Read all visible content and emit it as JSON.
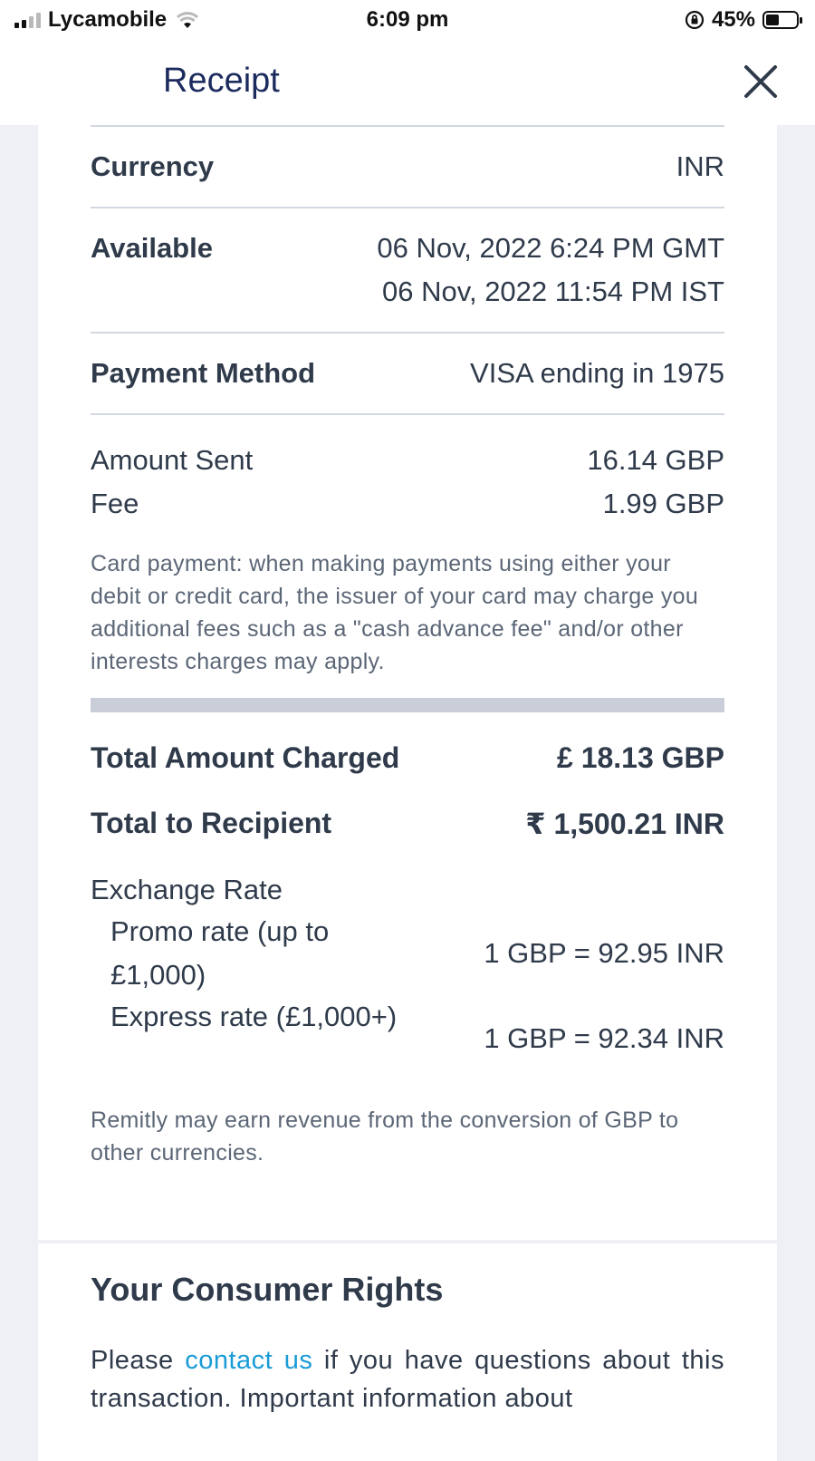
{
  "status_bar": {
    "carrier": "Lycamobile",
    "time": "6:09 pm",
    "battery": "45%",
    "battery_level": 0.45,
    "icons": [
      "signal-icon",
      "wifi-icon",
      "orientation-lock-icon",
      "battery-icon"
    ]
  },
  "header": {
    "title": "Receipt",
    "close_icon": "close-icon"
  },
  "details": {
    "currency": {
      "label": "Currency",
      "value": "INR"
    },
    "available": {
      "label": "Available",
      "value_gmt": "06 Nov, 2022 6:24 PM GMT",
      "value_ist": "06 Nov, 2022 11:54 PM IST"
    },
    "payment_method": {
      "label": "Payment Method",
      "value": "VISA ending in 1975"
    },
    "amount_sent": {
      "label": "Amount Sent",
      "value": "16.14 GBP"
    },
    "fee": {
      "label": "Fee",
      "value": "1.99 GBP"
    },
    "card_note": "Card payment: when making payments using either your debit or credit card, the issuer of your card may charge you additional fees such as a \"cash advance fee\" and/or other interests charges may apply."
  },
  "totals": {
    "charged": {
      "label": "Total Amount Charged",
      "value": "£ 18.13 GBP"
    },
    "recipient": {
      "label": "Total to Recipient",
      "value": "₹ 1,500.21 INR"
    }
  },
  "exchange": {
    "label": "Exchange Rate",
    "promo": {
      "label": "Promo rate (up to £1,000)",
      "value": "1 GBP = 92.95 INR"
    },
    "express": {
      "label": "Express rate (£1,000+)",
      "value": "1 GBP = 92.34 INR"
    },
    "note": "Remitly may earn revenue from the conversion of GBP to other currencies."
  },
  "consumer_rights": {
    "title": "Your Consumer Rights",
    "text_before": "Please ",
    "link": "contact us",
    "text_after": " if you have questions about this transaction. Important information about"
  },
  "colors": {
    "title": "#1c2b5e",
    "text": "#2f3a4a",
    "muted": "#5b6676",
    "link": "#1a9bd6",
    "background": "#eef0f5"
  }
}
